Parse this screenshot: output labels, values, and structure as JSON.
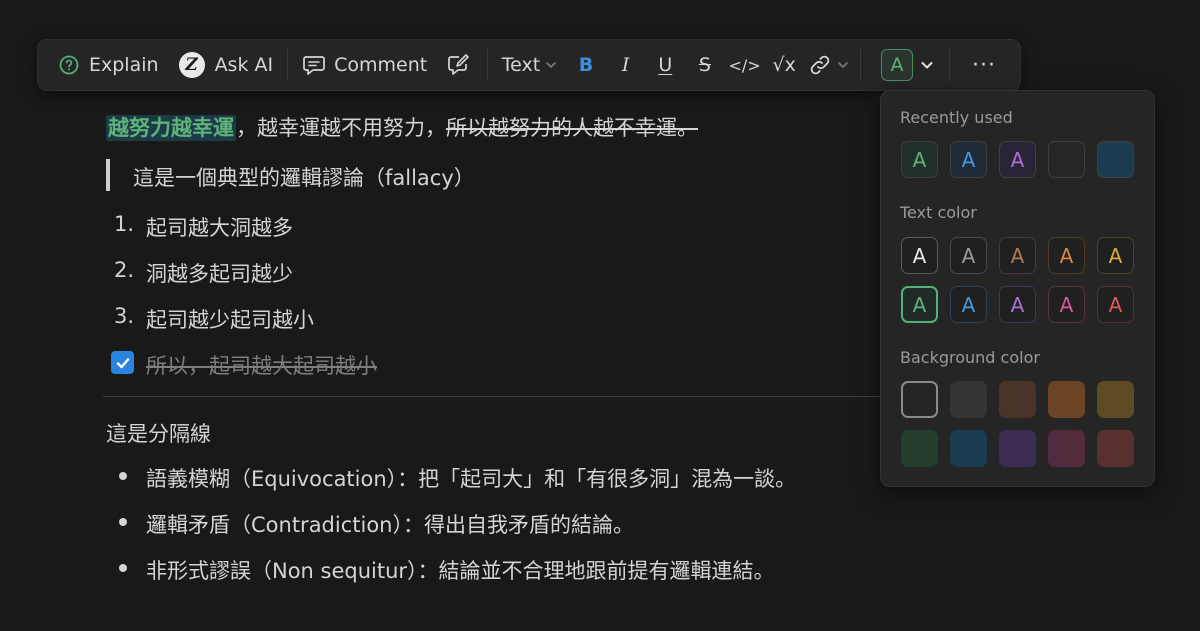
{
  "toolbar": {
    "explain": "Explain",
    "ask_ai": "Ask AI",
    "ask_ai_glyph": "Z",
    "comment": "Comment",
    "text_dropdown": "Text",
    "bold": "B",
    "italic": "I",
    "underline": "U",
    "strike": "S",
    "code": "</>",
    "math": "√x",
    "color_letter": "A",
    "more": "···"
  },
  "doc": {
    "first_line": {
      "highlighted": "越努力越幸運",
      "plain": "，越幸運越不用努力，",
      "struck": "所以越努力的人越不幸運。"
    },
    "quote": "這是一個典型的邏輯謬論（fallacy）",
    "ordered": [
      {
        "num": "1.",
        "text": "起司越大洞越多"
      },
      {
        "num": "2.",
        "text": "洞越多起司越少"
      },
      {
        "num": "3.",
        "text": "起司越少起司越小"
      }
    ],
    "todo": {
      "checked": true,
      "text": "所以，起司越大起司越小"
    },
    "after_divider": "這是分隔線",
    "bullets": [
      "語義模糊（Equivocation）：把「起司大」和「有很多洞」混為一談。",
      "邏輯矛盾（Contradiction）：得出自我矛盾的結論。",
      "非形式謬誤（Non sequitur）：結論並不合理地跟前提有邏輯連結。"
    ]
  },
  "color_menu": {
    "recent_title": "Recently used",
    "text_title": "Text color",
    "bg_title": "Background color",
    "letter": "A",
    "recent": [
      {
        "kind": "text",
        "color": "#5fb27a",
        "bg": "#22302a"
      },
      {
        "kind": "text",
        "color": "#3f9ae0",
        "bg": "#1f2b36"
      },
      {
        "kind": "text",
        "color": "#a871d6",
        "bg": "#2b2436"
      },
      {
        "kind": "bg",
        "color": "#262626"
      },
      {
        "kind": "bg",
        "color": "#1b3b4f"
      }
    ],
    "text_colors": [
      {
        "color": "#e8e8e8",
        "border": "#5a5a5a"
      },
      {
        "color": "#9b9b9b",
        "border": "#4a4a4a"
      },
      {
        "color": "#b07a5a",
        "border": "#4b3a30"
      },
      {
        "color": "#d98a3d",
        "border": "#4e3b27"
      },
      {
        "color": "#d9a93d",
        "border": "#4d4228"
      },
      {
        "color": "#5fb27a",
        "border": "#4fb27a",
        "selected": true
      },
      {
        "color": "#3f9ae0",
        "border": "#2b4257"
      },
      {
        "color": "#a871d6",
        "border": "#42345a"
      },
      {
        "color": "#d65a99",
        "border": "#55314a"
      },
      {
        "color": "#e05a54",
        "border": "#57302f"
      }
    ],
    "bg_colors": [
      {
        "color": "#252525",
        "border": "#8a8a8a",
        "selected": true
      },
      {
        "color": "#343434"
      },
      {
        "color": "#4a3328"
      },
      {
        "color": "#6a4425"
      },
      {
        "color": "#5e4a25"
      },
      {
        "color": "#243d2e"
      },
      {
        "color": "#1b3b4f"
      },
      {
        "color": "#3b2d52"
      },
      {
        "color": "#522b3e"
      },
      {
        "color": "#57302f"
      }
    ]
  }
}
